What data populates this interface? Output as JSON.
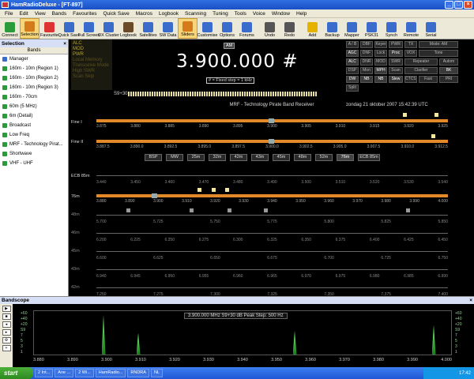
{
  "window": {
    "title": "HamRadioDeluxe - [FT-897]"
  },
  "menu": [
    "File",
    "Edit",
    "View",
    "Bands",
    "Favourites",
    "Quick Save",
    "Macros",
    "Logbook",
    "Scanning",
    "Tuning",
    "Tools",
    "Voice",
    "Window",
    "Help"
  ],
  "toolbar": [
    {
      "label": "Connect",
      "color": "#2a9a3a"
    },
    {
      "label": "Selection",
      "color": "#d47a1a",
      "active": true
    },
    {
      "label": "Favourite",
      "color": "#d33"
    },
    {
      "label": "Quick Save",
      "color": "#3b6ccb"
    },
    {
      "label": "Full Screen",
      "color": "#3b6ccb"
    },
    {
      "label": "DX Cluster",
      "color": "#3b6ccb"
    },
    {
      "label": "Logbook",
      "color": "#6b4a2a"
    },
    {
      "label": "Satellites",
      "color": "#3b6ccb"
    },
    {
      "label": "SW Data",
      "color": "#3b6ccb"
    },
    {
      "label": "Sliders",
      "color": "#d47a1a",
      "active": true
    },
    {
      "label": "Customise",
      "color": "#3b6ccb"
    },
    {
      "label": "Options",
      "color": "#3b6ccb"
    },
    {
      "label": "Forums",
      "color": "#3b6ccb"
    },
    {
      "label": "Undo",
      "color": "#555"
    },
    {
      "label": "Redo",
      "color": "#555"
    },
    {
      "label": "Add",
      "color": "#e5b200"
    },
    {
      "label": "Backup",
      "color": "#3b6ccb"
    },
    {
      "label": "Mapper",
      "color": "#3b6ccb"
    },
    {
      "label": "PSK31",
      "color": "#3b6ccb"
    },
    {
      "label": "Synch",
      "color": "#3b6ccb"
    },
    {
      "label": "Remote",
      "color": "#3b6ccb"
    },
    {
      "label": "Serial",
      "color": "#3b6ccb"
    }
  ],
  "selection_panel": {
    "title": "Selection",
    "subtitle": "Bands",
    "items": [
      {
        "label": "Manager",
        "folder": true
      },
      {
        "label": "160m - 10m (Region 1)"
      },
      {
        "label": "160m - 10m (Region 2)"
      },
      {
        "label": "160m - 10m (Region 3)"
      },
      {
        "label": "160m - 70cm"
      },
      {
        "label": "60m (5 MHz)"
      },
      {
        "label": "6m (Detail)"
      },
      {
        "label": "Broadcast"
      },
      {
        "label": "Low Freq"
      },
      {
        "label": "MRF - Technology Pirat..."
      },
      {
        "label": "Shortwave"
      },
      {
        "label": "VHF - UHF"
      }
    ]
  },
  "radio": {
    "status": [
      "ALC",
      "MOD",
      "PWR"
    ],
    "status_dim": [
      "Local Memory",
      "Transceive Mode",
      "High SWR",
      "Scan Skip"
    ],
    "mode_badge": "AM",
    "frequency": "3.900.000 #",
    "fixed_step": "# = Fixed step = 1 kHz",
    "smeter_label": "S9+30",
    "buttons": [
      "A / B",
      "DBF",
      "Keyer",
      "PWR",
      "TX",
      "Mode: AM",
      "AGC",
      "DNF",
      "Lock",
      "Proc",
      "VOX",
      "Tone",
      "ALC",
      "DNR",
      "MOD",
      "SWR",
      "Repeater",
      "Autom",
      "DSP",
      "Mon",
      "MPH",
      "Scan",
      "Clarifier",
      "BK",
      "DW",
      "NB",
      "NB",
      "Slew",
      "CTCSS",
      "Fast",
      "PRI",
      "Split"
    ],
    "band_title": "MRF - Technology  Pirate  Band  Receiver",
    "band_date": "zondag 21 oktober 2007 15:42:39 UTC",
    "fine1_label": "Fine I",
    "fine2_label": "Fine II",
    "fine1_ticks": [
      "3.875",
      "3.880",
      "3.885",
      "3.890",
      "3.895",
      "3.900",
      "3.905",
      "3.910",
      "3.915",
      "3.920",
      "3.925"
    ],
    "fine2_ticks": [
      "3.887.5",
      "3.890.0",
      "3.892.5",
      "3.895.0",
      "3.897.5",
      "3.900.0",
      "3.902.5",
      "3.905.0",
      "3.907.5",
      "3.910.0",
      "3.912.5"
    ],
    "band_buttons": [
      "BSP",
      "MW",
      "25m",
      "32m",
      "42m",
      "43m",
      "45m",
      "48m",
      "52m",
      "76m",
      "ECB 85m"
    ],
    "ecb_label": "ECB 85m",
    "ecb_ticks": [
      "3.440",
      "3.450",
      "3.460",
      "3.470",
      "3.480",
      "3.490",
      "3.500",
      "3.510",
      "3.520",
      "3.530",
      "3.540"
    ],
    "m76_label": "76m",
    "m76_ticks": [
      "3.880",
      "3.890",
      "3.900",
      "3.910",
      "3.920",
      "3.930",
      "3.940",
      "3.950",
      "3.960",
      "3.970",
      "3.980",
      "3.990",
      "4.000"
    ],
    "grey_rows": [
      {
        "label": "48m",
        "ticks": [
          "5.700",
          "5.725",
          "5.750",
          "5.775",
          "5.800",
          "5.825",
          "5.850"
        ]
      },
      {
        "label": "46m",
        "ticks": [
          "6.200",
          "6.225",
          "6.250",
          "6.275",
          "6.300",
          "6.325",
          "6.350",
          "6.375",
          "6.400",
          "6.425",
          "6.450"
        ]
      },
      {
        "label": "45m",
        "ticks": [
          "6.600",
          "6.625",
          "6.650",
          "6.675",
          "6.700",
          "6.725",
          "6.750"
        ]
      },
      {
        "label": "43m",
        "ticks": [
          "6.940",
          "6.945",
          "6.950",
          "6.955",
          "6.960",
          "6.965",
          "6.970",
          "6.975",
          "6.980",
          "6.985",
          "6.990"
        ]
      },
      {
        "label": "42m",
        "ticks": [
          "7.250",
          "7.275",
          "7.300",
          "7.325",
          "7.350",
          "7.375",
          "7.400"
        ]
      }
    ]
  },
  "bandscope": {
    "title": "Bandscope",
    "info": "3.900.000 MHz   S9+30 dB  Peak    Step: 500 Hz",
    "db_labels": [
      "+60",
      "+40",
      "+20",
      "S9",
      "7",
      "5",
      "3",
      "1"
    ],
    "freqs": [
      "3.880",
      "3.890",
      "3.900",
      "3.910",
      "3.920",
      "3.930",
      "3.940",
      "3.950",
      "3.960",
      "3.970",
      "3.980",
      "3.990",
      "4.000"
    ],
    "peaks": [
      {
        "freq": 3.9,
        "level": 1.0
      },
      {
        "freq": 3.91,
        "level": 0.55
      },
      {
        "freq": 3.955,
        "level": 0.6
      },
      {
        "freq": 3.995,
        "level": 0.75
      }
    ]
  },
  "taskbar": {
    "start": "start",
    "windows": [
      "2 Int...",
      "Ane ...",
      "2 Wi...",
      "HamRadio...",
      "RNDRA",
      "NL"
    ],
    "clock": "17:42"
  }
}
